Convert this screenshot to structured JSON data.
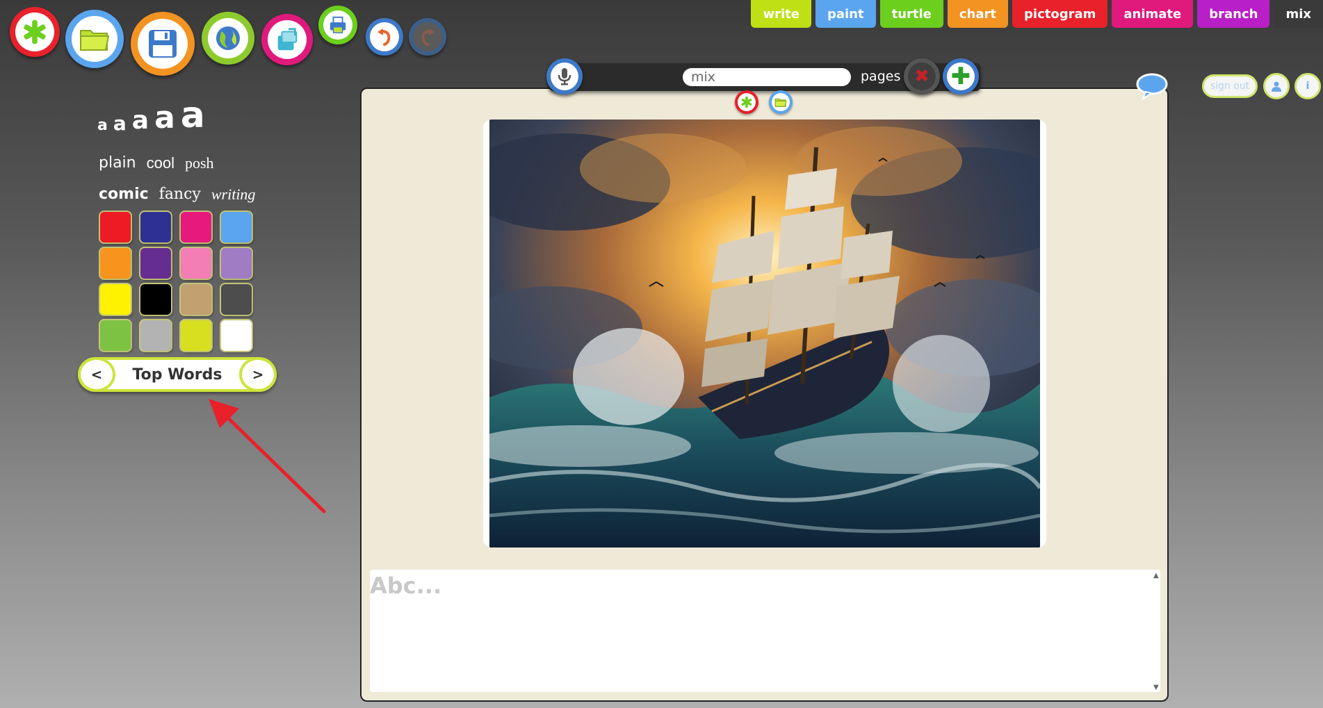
{
  "toolbar": {
    "buttons": [
      {
        "name": "new",
        "icon": "asterisk-icon",
        "ring": "#e8212b",
        "fill": "#ffffff",
        "icon_color": "#6ccf1e"
      },
      {
        "name": "open",
        "icon": "folder-icon",
        "ring": "#5aa5ee",
        "fill": "#ffffff",
        "icon_color": "#bfe033"
      },
      {
        "name": "save",
        "icon": "floppy-disk-icon",
        "ring": "#f39322",
        "fill": "#ffffff",
        "icon_color": "#3d79c9"
      },
      {
        "name": "share",
        "icon": "globe-icon",
        "ring": "#8dcb2c",
        "fill": "#ffffff",
        "icon_color": "#3d79c9"
      },
      {
        "name": "export",
        "icon": "export-icon",
        "ring": "#e0197d",
        "fill": "#ffffff",
        "icon_color": "#3fb5d0"
      },
      {
        "name": "print",
        "icon": "printer-icon",
        "ring": "#6ccf1e",
        "fill": "#ffffff",
        "icon_color": "#3d79c9"
      },
      {
        "name": "undo",
        "icon": "undo-icon",
        "ring": "#3d79c9",
        "fill": "#ffffff",
        "icon_color": "#e8662b"
      },
      {
        "name": "redo",
        "icon": "redo-icon",
        "ring": "#3d5f87",
        "fill": "#5a5a5a",
        "icon_color": "#8a5a4a"
      }
    ]
  },
  "tabs": [
    {
      "label": "write",
      "color": "#bfe015"
    },
    {
      "label": "paint",
      "color": "#5aa5ee"
    },
    {
      "label": "turtle",
      "color": "#6ccf1e"
    },
    {
      "label": "chart",
      "color": "#f39322"
    },
    {
      "label": "pictogram",
      "color": "#e8212b"
    },
    {
      "label": "animate",
      "color": "#e0197d"
    },
    {
      "label": "branch",
      "color": "#b91fc7"
    },
    {
      "label": "mix",
      "color": "#3a3a3a",
      "active": true
    }
  ],
  "pagebar": {
    "page_name": "mix",
    "pages_label": "pages",
    "mic_icon": "microphone-icon",
    "delete_icon": "close-icon",
    "add_icon": "plus-icon"
  },
  "account": {
    "sign_out_label": "sign out",
    "user_icon": "user-icon",
    "info_label": "i"
  },
  "left_panel": {
    "sizes": [
      "a",
      "a",
      "a",
      "a",
      "a"
    ],
    "fonts_row1": [
      "plain",
      "cool",
      "posh"
    ],
    "fonts_row2": [
      "comic",
      "fancy",
      "writing"
    ],
    "colors": [
      "#ed1c24",
      "#2e3192",
      "#e6197d",
      "#5aa5ee",
      "#f7941d",
      "#662d91",
      "#f27eb5",
      "#a07cc5",
      "#fff200",
      "#000000",
      "#c2a070",
      "#4d4d4d",
      "#7dc242",
      "#b3b3b3",
      "#d7df20",
      "#ffffff"
    ],
    "top_words": {
      "label": "Top Words",
      "prev": "<",
      "next": ">"
    }
  },
  "page": {
    "mini_new_icon": "asterisk-icon",
    "mini_open_icon": "folder-icon",
    "image_alt": "sailing ship in stormy sea",
    "text_placeholder": "Abc..."
  }
}
